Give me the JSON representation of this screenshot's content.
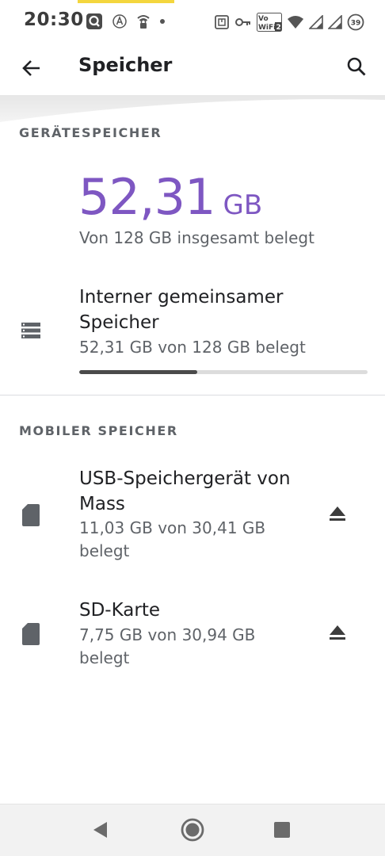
{
  "status_bar": {
    "time": "20:30",
    "left_icons": [
      "q-app-icon",
      "location-a-icon",
      "wifi-lock-icon",
      "dot-icon"
    ],
    "right_icons": [
      "nfc-icon",
      "key-icon",
      "vowifi-icon",
      "wifi-signal-icon",
      "cell-signal-icon",
      "cell-signal-icon",
      "battery-icon"
    ],
    "vowifi_label": "Vo WiFi",
    "vowifi_badge": "2",
    "battery_level": "39"
  },
  "app_bar": {
    "title": "Speicher",
    "back_icon": "arrow-back-icon",
    "search_icon": "search-icon"
  },
  "device_storage": {
    "header": "GERÄTESPEICHER",
    "used_value": "52,31",
    "used_unit": "GB",
    "summary": "Von 128 GB insgesamt belegt",
    "internal": {
      "icon": "storage-list-icon",
      "title": "Interner gemeinsamer Speicher",
      "subtitle": "52,31 GB von 128 GB belegt",
      "used_fraction": 0.4087
    }
  },
  "portable_storage": {
    "header": "MOBILER SPEICHER",
    "items": [
      {
        "icon": "sd-card-icon",
        "title": "USB-Speichergerät von Mass",
        "subtitle": "11,03 GB von 30,41 GB belegt",
        "action_icon": "eject-icon"
      },
      {
        "icon": "sd-card-icon",
        "title": "SD-Karte",
        "subtitle": "7,75 GB von 30,94 GB belegt",
        "action_icon": "eject-icon"
      }
    ]
  },
  "nav_bar": {
    "buttons": [
      "back-triangle-icon",
      "home-circle-icon",
      "recents-square-icon"
    ]
  },
  "colors": {
    "accent_purple": "#7e57c2",
    "status_accent_yellow": "#f4d63e",
    "progress_fill": "#4a4a4a",
    "progress_track": "#dcdcdc"
  }
}
